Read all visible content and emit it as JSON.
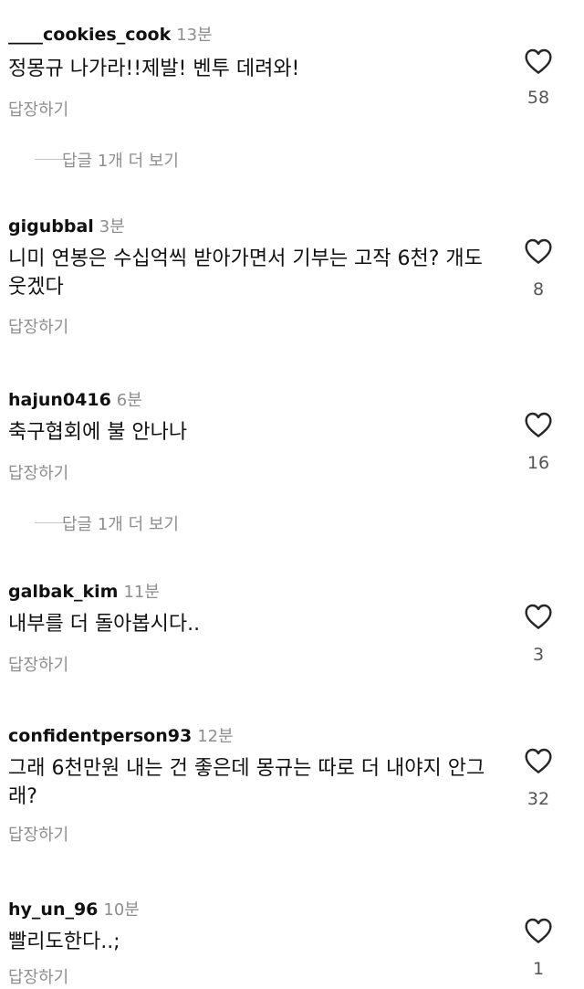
{
  "comments": [
    {
      "username": "____cookies_cook",
      "time": "13분",
      "text": "정몽규 나가라!!제발! 벤투 데려와!",
      "reply": "답장하기",
      "likes": "58"
    },
    {
      "username": "gigubbal",
      "time": "3분",
      "text": "니미 연봉은 수십억씩 받아가면서 기부는 고작 6천? 개도 웃겠다",
      "reply": "답장하기",
      "likes": "8"
    },
    {
      "username": "hajun0416",
      "time": "6분",
      "text": "축구협회에 불 안나나",
      "reply": "답장하기",
      "likes": "16"
    },
    {
      "username": "galbak_kim",
      "time": "11분",
      "text": "내부를 더 돌아봅시다..",
      "reply": "답장하기",
      "likes": "3"
    },
    {
      "username": "confidentperson93",
      "time": "12분",
      "text": "그래 6천만원 내는 건 좋은데 몽규는 따로 더 내야지 안그래?",
      "reply": "답장하기",
      "likes": "32"
    },
    {
      "username": "hy_un_96",
      "time": "10분",
      "text": "빨리도한다..;",
      "reply": "답장하기",
      "likes": "1"
    }
  ],
  "view_replies": [
    {
      "label": "답글 1개 더 보기"
    },
    {
      "label": "답글 1개 더 보기"
    }
  ],
  "icons": {
    "like": "heart-outline-icon"
  }
}
